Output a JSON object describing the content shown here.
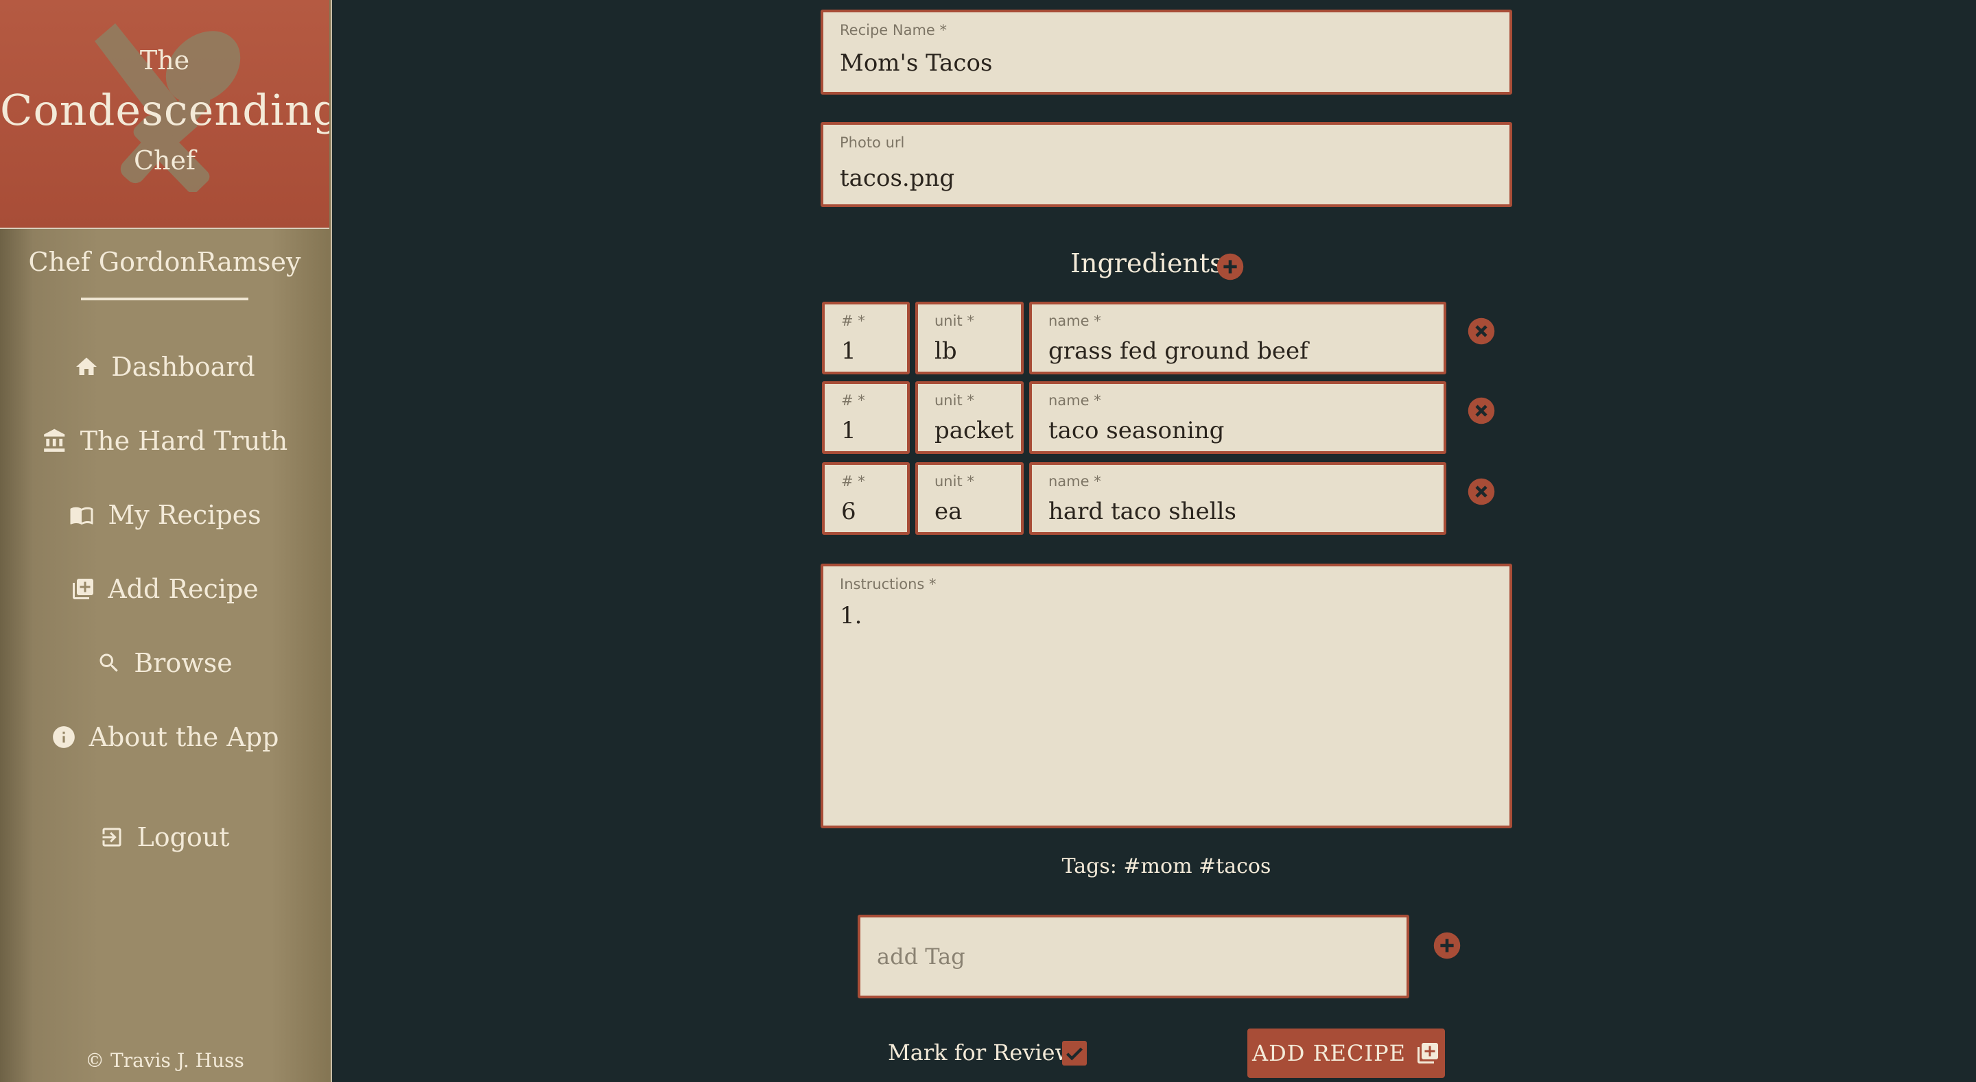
{
  "app": {
    "logo": {
      "line1": "The",
      "line2": "Condescending",
      "line3": "Chef"
    },
    "user_name": "Chef GordonRamsey",
    "copyright": "© Travis J. Huss"
  },
  "nav": [
    {
      "label": "Dashboard",
      "icon": "home-icon"
    },
    {
      "label": "The Hard Truth",
      "icon": "bank-icon"
    },
    {
      "label": "My Recipes",
      "icon": "book-icon"
    },
    {
      "label": "Add Recipe",
      "icon": "add-box-icon"
    },
    {
      "label": "Browse",
      "icon": "search-icon"
    },
    {
      "label": "About the App",
      "icon": "info-icon"
    },
    {
      "label": "Logout",
      "icon": "logout-icon"
    }
  ],
  "form": {
    "recipe_name": {
      "label": "Recipe Name *",
      "value": "Mom's Tacos"
    },
    "photo_url": {
      "label": "Photo url",
      "value": "tacos.png"
    },
    "ingredients_title": "Ingredients",
    "ingredient_labels": {
      "qty": "# *",
      "unit": "unit *",
      "name": "name *"
    },
    "ingredients": [
      {
        "qty": "1",
        "unit": "lb",
        "name": "grass fed ground beef"
      },
      {
        "qty": "1",
        "unit": "packet",
        "name": "taco seasoning"
      },
      {
        "qty": "6",
        "unit": "ea",
        "name": "hard taco shells"
      }
    ],
    "instructions": {
      "label": "Instructions *",
      "value": "1."
    },
    "tags_line": "Tags: #mom #tacos",
    "tag_input_placeholder": "add Tag",
    "review_label": "Mark for Review",
    "review_checked": true,
    "submit_label": "ADD RECIPE"
  },
  "colors": {
    "background": "#1b282b",
    "accent": "#a84d37",
    "field_bg": "#e7dfcc",
    "sidebar": "#9a8a68",
    "text_light": "#f3ead8"
  }
}
